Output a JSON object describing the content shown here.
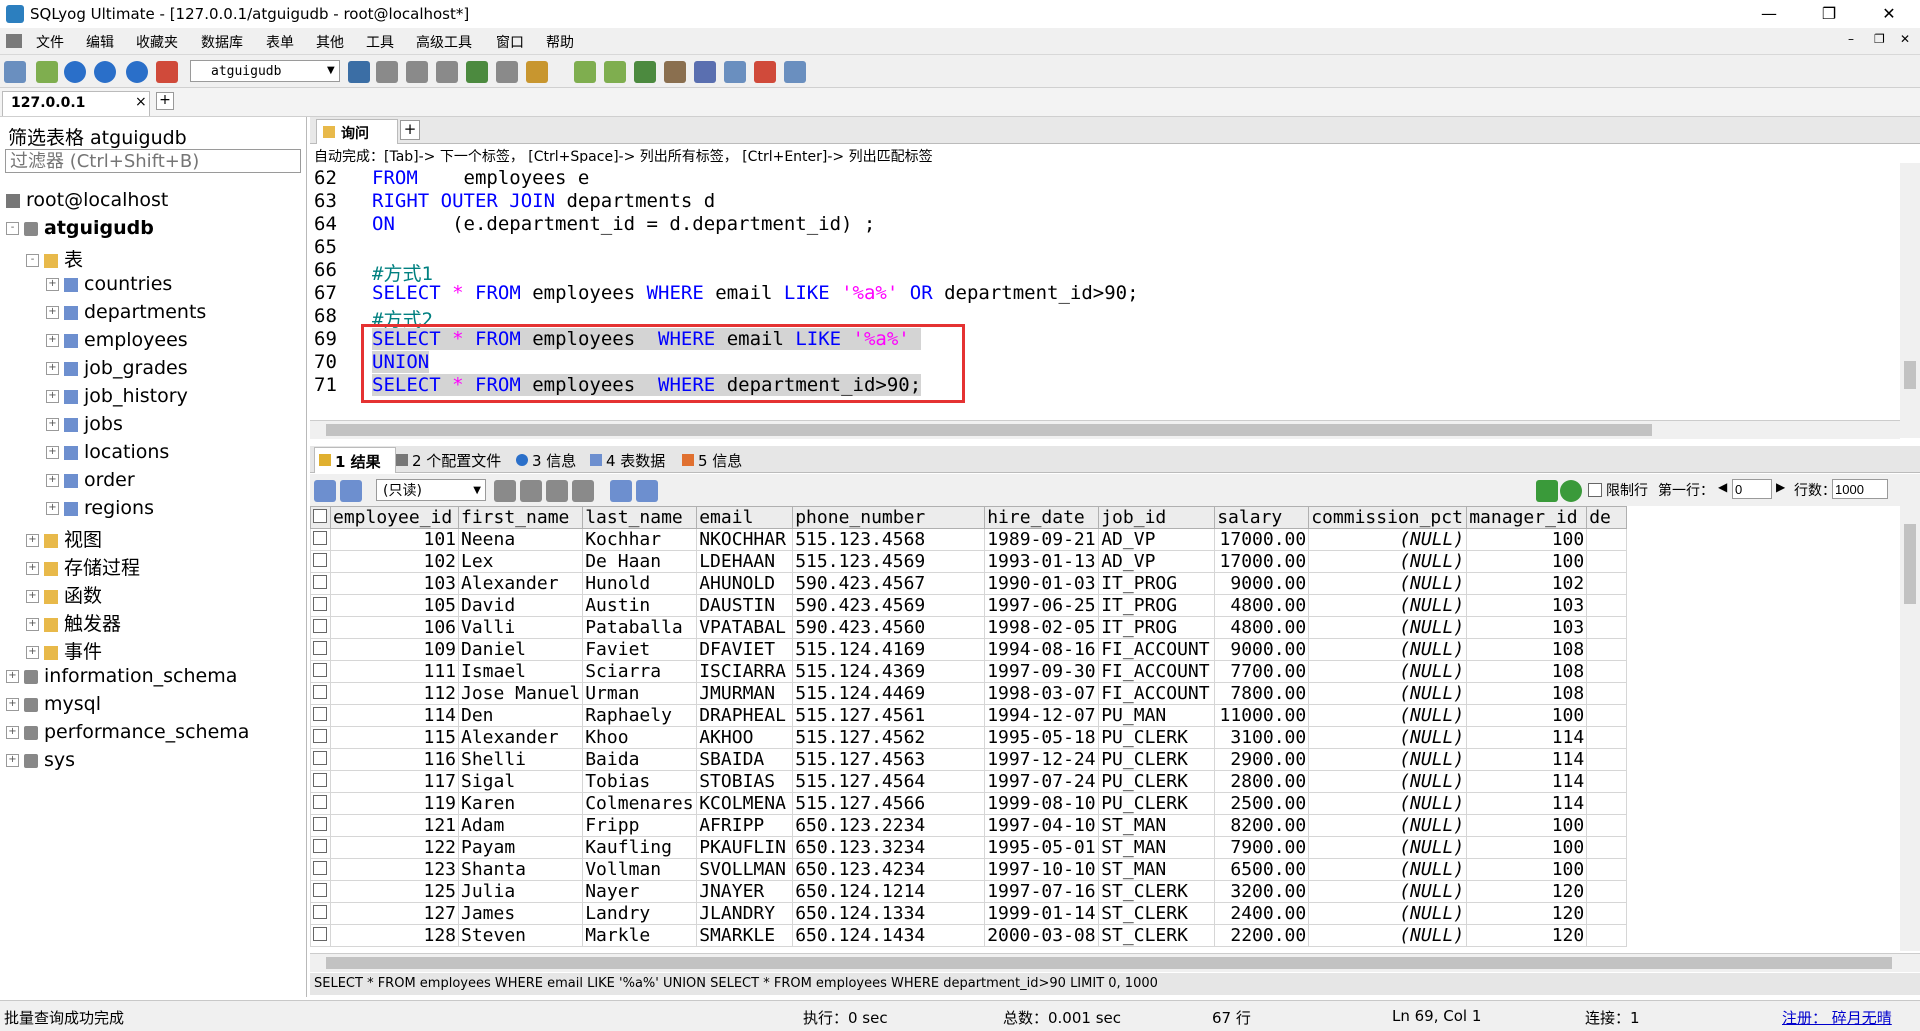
{
  "window": {
    "title": "SQLyog Ultimate - [127.0.0.1/atguigudb - root@localhost*]"
  },
  "menu": [
    "文件",
    "编辑",
    "收藏夹",
    "数据库",
    "表单",
    "其他",
    "工具",
    "高级工具",
    "窗口",
    "帮助"
  ],
  "toolbar": {
    "db_select": "atguigudb"
  },
  "conn_tab": {
    "label": "127.0.0.1",
    "close": "×",
    "add": "+"
  },
  "left": {
    "filter_title": "筛选表格 atguigudb",
    "filter_placeholder": "过滤器 (Ctrl+Shift+B)",
    "tree": [
      {
        "label": "root@localhost",
        "level": 0,
        "icon": "server-icon",
        "toggle": ""
      },
      {
        "label": "atguigudb",
        "level": 0,
        "icon": "database-icon",
        "toggle": "-",
        "bold": true
      },
      {
        "label": "表",
        "level": 1,
        "icon": "folder-icon",
        "toggle": "-"
      },
      {
        "label": "countries",
        "level": 2,
        "icon": "table-icon",
        "toggle": "+"
      },
      {
        "label": "departments",
        "level": 2,
        "icon": "table-icon",
        "toggle": "+"
      },
      {
        "label": "employees",
        "level": 2,
        "icon": "table-icon",
        "toggle": "+"
      },
      {
        "label": "job_grades",
        "level": 2,
        "icon": "table-icon",
        "toggle": "+"
      },
      {
        "label": "job_history",
        "level": 2,
        "icon": "table-icon",
        "toggle": "+"
      },
      {
        "label": "jobs",
        "level": 2,
        "icon": "table-icon",
        "toggle": "+"
      },
      {
        "label": "locations",
        "level": 2,
        "icon": "table-icon",
        "toggle": "+"
      },
      {
        "label": "order",
        "level": 2,
        "icon": "table-icon",
        "toggle": "+"
      },
      {
        "label": "regions",
        "level": 2,
        "icon": "table-icon",
        "toggle": "+"
      },
      {
        "label": "视图",
        "level": 1,
        "icon": "folder-icon",
        "toggle": "+"
      },
      {
        "label": "存储过程",
        "level": 1,
        "icon": "folder-icon",
        "toggle": "+"
      },
      {
        "label": "函数",
        "level": 1,
        "icon": "folder-icon",
        "toggle": "+"
      },
      {
        "label": "触发器",
        "level": 1,
        "icon": "folder-icon",
        "toggle": "+"
      },
      {
        "label": "事件",
        "level": 1,
        "icon": "folder-icon",
        "toggle": "+"
      },
      {
        "label": "information_schema",
        "level": 0,
        "icon": "database-icon",
        "toggle": "+"
      },
      {
        "label": "mysql",
        "level": 0,
        "icon": "database-icon",
        "toggle": "+"
      },
      {
        "label": "performance_schema",
        "level": 0,
        "icon": "database-icon",
        "toggle": "+"
      },
      {
        "label": "sys",
        "level": 0,
        "icon": "database-icon",
        "toggle": "+"
      }
    ]
  },
  "query": {
    "tab_label": "询问",
    "tab_add": "+",
    "autocomplete_hint": "自动完成：[Tab]-> 下一个标签， [Ctrl+Space]-> 列出所有标签， [Ctrl+Enter]-> 列出匹配标签",
    "line_numbers": [
      "62",
      "63",
      "64",
      "65",
      "66",
      "67",
      "68",
      "69",
      "70",
      "71"
    ]
  },
  "result_tabs": [
    "1 结果",
    "2 个配置文件",
    "3 信息",
    "4 表数据",
    "5 信息"
  ],
  "result_toolbar": {
    "mode": "(只读)",
    "limit_label": "限制行",
    "first_row_label": "第一行：",
    "first_row_value": "0",
    "rows_label": "行数：",
    "rows_value": "1000"
  },
  "grid": {
    "columns": [
      "employee_id",
      "first_name",
      "last_name",
      "email",
      "phone_number",
      "hire_date",
      "job_id",
      "salary",
      "commission_pct",
      "manager_id",
      "de"
    ],
    "rows": [
      [
        "101",
        "Neena",
        "Kochhar",
        "NKOCHHAR",
        "515.123.4568",
        "1989-09-21",
        "AD_VP",
        "17000.00",
        "(NULL)",
        "100"
      ],
      [
        "102",
        "Lex",
        "De Haan",
        "LDEHAAN",
        "515.123.4569",
        "1993-01-13",
        "AD_VP",
        "17000.00",
        "(NULL)",
        "100"
      ],
      [
        "103",
        "Alexander",
        "Hunold",
        "AHUNOLD",
        "590.423.4567",
        "1990-01-03",
        "IT_PROG",
        "9000.00",
        "(NULL)",
        "102"
      ],
      [
        "105",
        "David",
        "Austin",
        "DAUSTIN",
        "590.423.4569",
        "1997-06-25",
        "IT_PROG",
        "4800.00",
        "(NULL)",
        "103"
      ],
      [
        "106",
        "Valli",
        "Pataballa",
        "VPATABAL",
        "590.423.4560",
        "1998-02-05",
        "IT_PROG",
        "4800.00",
        "(NULL)",
        "103"
      ],
      [
        "109",
        "Daniel",
        "Faviet",
        "DFAVIET",
        "515.124.4169",
        "1994-08-16",
        "FI_ACCOUNT",
        "9000.00",
        "(NULL)",
        "108"
      ],
      [
        "111",
        "Ismael",
        "Sciarra",
        "ISCIARRA",
        "515.124.4369",
        "1997-09-30",
        "FI_ACCOUNT",
        "7700.00",
        "(NULL)",
        "108"
      ],
      [
        "112",
        "Jose Manuel",
        "Urman",
        "JMURMAN",
        "515.124.4469",
        "1998-03-07",
        "FI_ACCOUNT",
        "7800.00",
        "(NULL)",
        "108"
      ],
      [
        "114",
        "Den",
        "Raphaely",
        "DRAPHEAL",
        "515.127.4561",
        "1994-12-07",
        "PU_MAN",
        "11000.00",
        "(NULL)",
        "100"
      ],
      [
        "115",
        "Alexander",
        "Khoo",
        "AKHOO",
        "515.127.4562",
        "1995-05-18",
        "PU_CLERK",
        "3100.00",
        "(NULL)",
        "114"
      ],
      [
        "116",
        "Shelli",
        "Baida",
        "SBAIDA",
        "515.127.4563",
        "1997-12-24",
        "PU_CLERK",
        "2900.00",
        "(NULL)",
        "114"
      ],
      [
        "117",
        "Sigal",
        "Tobias",
        "STOBIAS",
        "515.127.4564",
        "1997-07-24",
        "PU_CLERK",
        "2800.00",
        "(NULL)",
        "114"
      ],
      [
        "119",
        "Karen",
        "Colmenares",
        "KCOLMENA",
        "515.127.4566",
        "1999-08-10",
        "PU_CLERK",
        "2500.00",
        "(NULL)",
        "114"
      ],
      [
        "121",
        "Adam",
        "Fripp",
        "AFRIPP",
        "650.123.2234",
        "1997-04-10",
        "ST_MAN",
        "8200.00",
        "(NULL)",
        "100"
      ],
      [
        "122",
        "Payam",
        "Kaufling",
        "PKAUFLIN",
        "650.123.3234",
        "1995-05-01",
        "ST_MAN",
        "7900.00",
        "(NULL)",
        "100"
      ],
      [
        "123",
        "Shanta",
        "Vollman",
        "SVOLLMAN",
        "650.123.4234",
        "1997-10-10",
        "ST_MAN",
        "6500.00",
        "(NULL)",
        "100"
      ],
      [
        "125",
        "Julia",
        "Nayer",
        "JNAYER",
        "650.124.1214",
        "1997-07-16",
        "ST_CLERK",
        "3200.00",
        "(NULL)",
        "120"
      ],
      [
        "127",
        "James",
        "Landry",
        "JLANDRY",
        "650.124.1334",
        "1999-01-14",
        "ST_CLERK",
        "2400.00",
        "(NULL)",
        "120"
      ],
      [
        "128",
        "Steven",
        "Markle",
        "SMARKLE",
        "650.124.1434",
        "2000-03-08",
        "ST_CLERK",
        "2200.00",
        "(NULL)",
        "120"
      ]
    ]
  },
  "sqlbar": "SELECT * FROM employees WHERE email LIKE '%a%' UNION SELECT * FROM employees WHERE department_id>90 LIMIT 0, 1000",
  "status": {
    "message": "批量查询成功完成",
    "exec": "执行：0 sec",
    "total": "总数：0.001 sec",
    "rows": "67 行",
    "pos": "Ln 69, Col 1",
    "conn": "连接：1",
    "register": "注册： 碎月无晴"
  }
}
